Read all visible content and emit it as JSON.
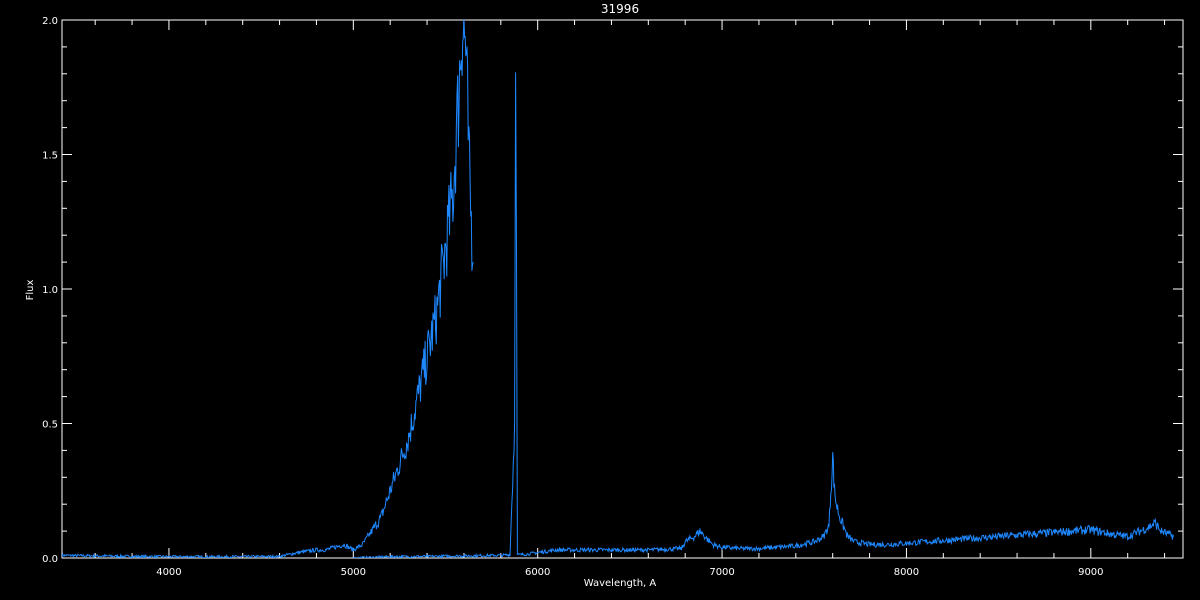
{
  "chart_data": {
    "type": "line",
    "title": "31996",
    "xlabel": "Wavelength, A",
    "ylabel": "Flux",
    "xlim": [
      3420,
      9500
    ],
    "ylim": [
      0,
      2.0
    ],
    "x_ticks": [
      4000,
      5000,
      6000,
      7000,
      8000,
      9000
    ],
    "x_tick_labels": [
      "4000",
      "5000",
      "6000",
      "7000",
      "8000",
      "9000"
    ],
    "y_ticks": [
      0,
      0.5,
      1.0,
      1.5,
      2.0
    ],
    "y_tick_labels": [
      "0.0",
      "0.5",
      "1.0",
      "1.5",
      "2.0"
    ],
    "grid": false,
    "colors": {
      "background": "#000000",
      "axes": "#ffffff",
      "series": "#1e88ff"
    },
    "series": [
      {
        "x": [
          3420,
          3600,
          3800,
          4000,
          4200,
          4400,
          4600,
          4700,
          4750,
          4800,
          4850,
          4900,
          4950,
          5000,
          5050,
          5100,
          5150,
          5200,
          5250,
          5300,
          5350,
          5400,
          5450,
          5500,
          5540,
          5570,
          5590,
          5610,
          5630,
          5650
        ],
        "y": [
          0.01,
          0.008,
          0.006,
          0.005,
          0.005,
          0.005,
          0.006,
          0.02,
          0.025,
          0.03,
          0.03,
          0.04,
          0.05,
          0.03,
          0.05,
          0.1,
          0.15,
          0.25,
          0.35,
          0.45,
          0.6,
          0.75,
          0.9,
          1.15,
          1.35,
          1.7,
          2.0,
          1.9,
          1.4,
          1.1
        ]
      },
      {
        "x": [
          5000,
          5200,
          5400,
          5600,
          5800,
          5850,
          5875,
          5880,
          5885,
          5890,
          5900,
          5950,
          6000,
          6100,
          6200,
          6400,
          6600,
          6780,
          6800,
          6850,
          6880,
          6920,
          6950,
          7000,
          7100,
          7200,
          7300,
          7400,
          7500,
          7550,
          7580,
          7600,
          7610,
          7620,
          7640,
          7680,
          7720,
          7800,
          7900,
          8000,
          8200,
          8400,
          8600,
          8800,
          9000,
          9100,
          9200,
          9300,
          9350,
          9380,
          9450
        ],
        "y": [
          0.0,
          0.005,
          0.006,
          0.008,
          0.01,
          0.012,
          0.5,
          2.0,
          1.3,
          0.012,
          0.012,
          0.015,
          0.02,
          0.03,
          0.03,
          0.03,
          0.03,
          0.035,
          0.06,
          0.08,
          0.1,
          0.07,
          0.05,
          0.04,
          0.035,
          0.035,
          0.04,
          0.045,
          0.06,
          0.08,
          0.12,
          0.38,
          0.25,
          0.2,
          0.15,
          0.08,
          0.06,
          0.05,
          0.05,
          0.055,
          0.065,
          0.075,
          0.085,
          0.095,
          0.105,
          0.09,
          0.08,
          0.11,
          0.13,
          0.1,
          0.08
        ]
      }
    ]
  }
}
